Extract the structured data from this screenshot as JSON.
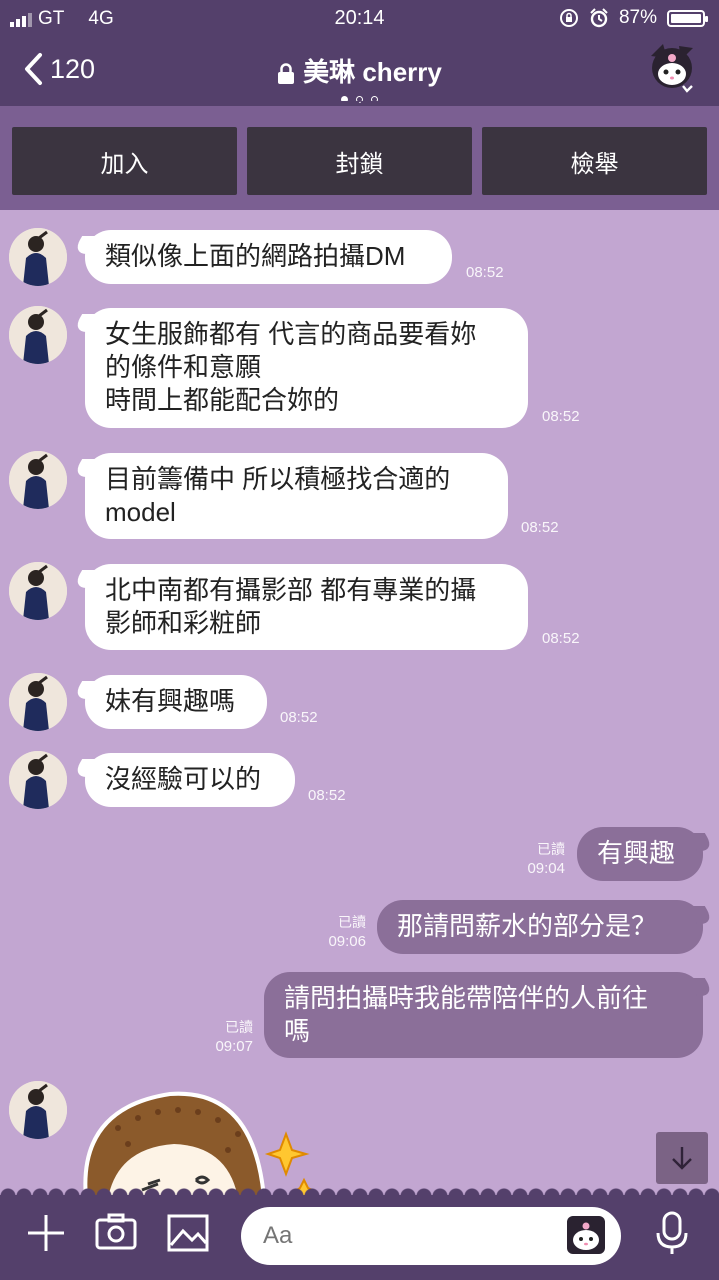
{
  "status_bar": {
    "carrier": "GT",
    "network": "4G",
    "time": "20:14",
    "battery": "87%",
    "battery_level": 0.87
  },
  "header": {
    "back_label": "120",
    "title": "美琳 cherry"
  },
  "actions": {
    "add": "加入",
    "block": "封鎖",
    "report": "檢舉"
  },
  "messages": [
    {
      "side": "in",
      "text": "類似像上面的網路拍攝DM",
      "time": "08:52"
    },
    {
      "side": "in",
      "text": "女生服飾都有 代言的商品要看妳\n的條件和意願\n時間上都能配合妳的",
      "time": "08:52"
    },
    {
      "side": "in",
      "text": "目前籌備中  所以積極找合適的\nmodel",
      "time": "08:52"
    },
    {
      "side": "in",
      "text": "北中南都有攝影部 都有專業的攝\n影師和彩粧師",
      "time": "08:52"
    },
    {
      "side": "in",
      "text": "妹有興趣嗎",
      "time": "08:52"
    },
    {
      "side": "in",
      "text": "沒經驗可以的",
      "time": "08:52"
    },
    {
      "side": "out",
      "text": "有興趣",
      "read": "已讀",
      "time": "09:04"
    },
    {
      "side": "out",
      "text": "那請問薪水的部分是？",
      "read": "已讀",
      "time": "09:06"
    },
    {
      "side": "out",
      "text": "請問拍攝時我能帶陪伴的人前往\n嗎",
      "read": "已讀",
      "time": "09:07"
    }
  ],
  "input": {
    "placeholder": "Aa"
  },
  "colors": {
    "header": "#54406b",
    "chat_bg": "#c2a6d1",
    "action_bar": "#7b5f92",
    "action_button": "#3b3440",
    "outgoing_bubble": "#8b6f99"
  },
  "icons": {
    "back": "chevron-left-icon",
    "lock": "lock-icon",
    "add": "plus-icon",
    "camera": "camera-icon",
    "image": "image-icon",
    "emoji": "kuromi-emoji-icon",
    "mic": "microphone-icon",
    "scroll": "arrow-down-icon"
  }
}
